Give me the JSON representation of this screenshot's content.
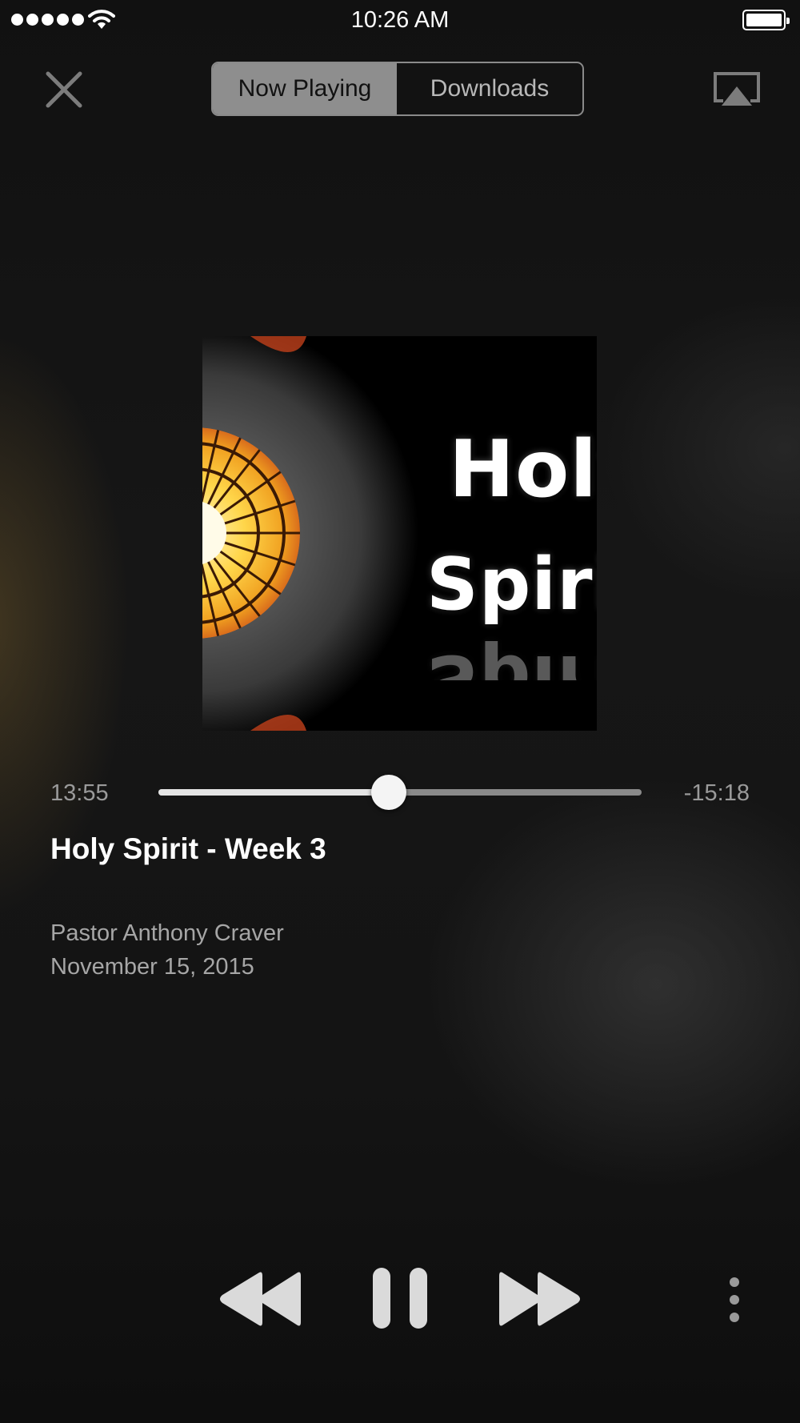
{
  "status_bar": {
    "time": "10:26 AM",
    "signal_icon": "cellular-signal-dots-icon",
    "wifi_icon": "wifi-icon",
    "battery_icon": "battery-full-icon"
  },
  "header": {
    "close_icon": "close-icon",
    "tabs": [
      {
        "label": "Now Playing",
        "selected": true
      },
      {
        "label": "Downloads",
        "selected": false
      }
    ],
    "airplay_icon": "airplay-icon"
  },
  "artwork": {
    "line1": "Holy",
    "line2": "Spirit",
    "reflection": "Spirit"
  },
  "player": {
    "elapsed": "13:55",
    "remaining": "-15:18",
    "progress": 0.477,
    "title": "Holy Spirit - Week 3",
    "speaker": "Pastor Anthony Craver",
    "date": "November 15, 2015"
  },
  "controls": {
    "rewind_icon": "rewind-icon",
    "pause_icon": "pause-icon",
    "forward_icon": "fast-forward-icon",
    "more_icon": "more-vertical-icon"
  },
  "colors": {
    "background": "#141414",
    "accent_segment": "#8e8e8e",
    "secondary_text": "#a6a6a6",
    "track_played": "#e4e4e4",
    "track_unplayed": "#8a8a8a"
  }
}
